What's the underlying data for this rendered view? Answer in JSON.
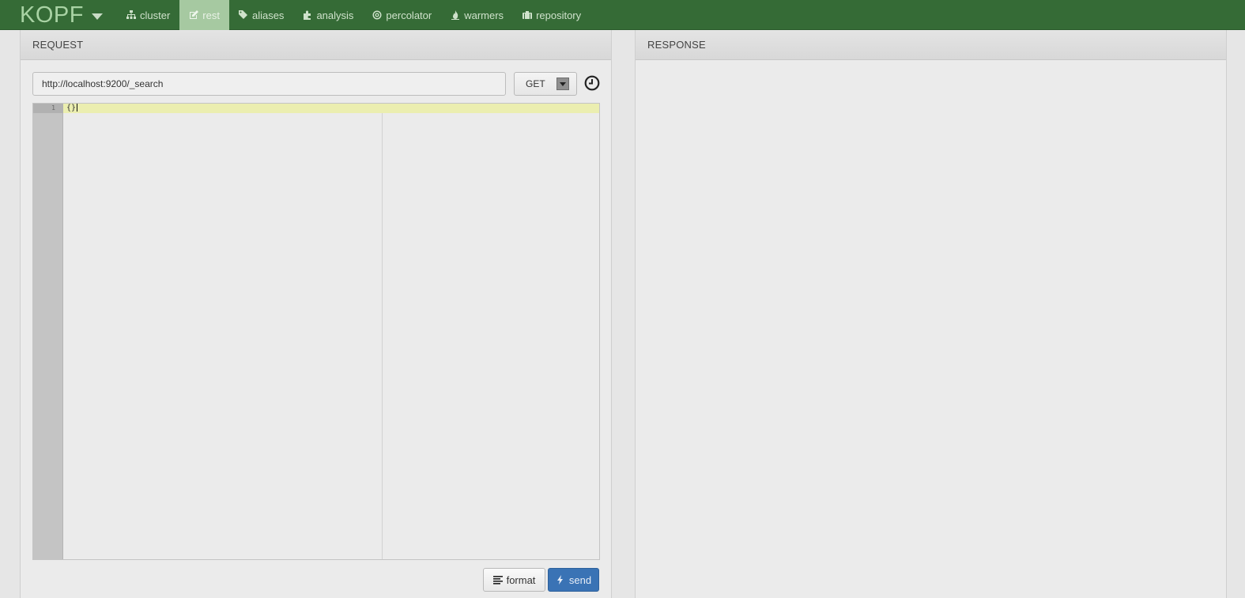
{
  "navbar": {
    "brand": "KOPF",
    "items": [
      {
        "label": "cluster",
        "icon": "sitemap-icon",
        "active": false
      },
      {
        "label": "rest",
        "icon": "edit-icon",
        "active": true
      },
      {
        "label": "aliases",
        "icon": "tags-icon",
        "active": false
      },
      {
        "label": "analysis",
        "icon": "puzzle-icon",
        "active": false
      },
      {
        "label": "percolator",
        "icon": "bullseye-icon",
        "active": false
      },
      {
        "label": "warmers",
        "icon": "fire-icon",
        "active": false
      },
      {
        "label": "repository",
        "icon": "briefcase-icon",
        "active": false
      }
    ]
  },
  "request": {
    "title": "REQUEST",
    "url": "http://localhost:9200/_search",
    "method": "GET",
    "editor": {
      "line_number": "1",
      "content": "{}"
    },
    "format_label": "format",
    "send_label": "send"
  },
  "response": {
    "title": "RESPONSE"
  },
  "colors": {
    "navbar": "#356b36",
    "brand": "#a9d3a4",
    "active_tab": "#a6c9a1",
    "send_button": "#3a73b5",
    "active_line": "#ebeeb0"
  }
}
